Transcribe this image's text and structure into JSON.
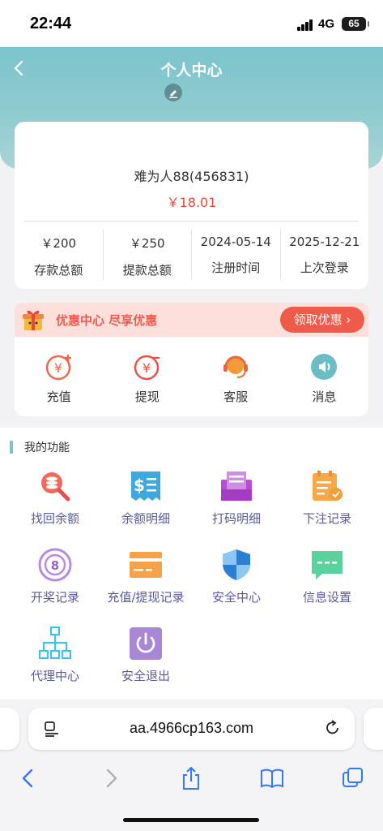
{
  "status": {
    "time": "22:44",
    "network": "4G",
    "battery": "65"
  },
  "header": {
    "title": "个人中心"
  },
  "profile": {
    "username": "难为人88(456831)",
    "balance": "￥18.01",
    "stats": [
      {
        "value": "￥200",
        "label": "存款总额"
      },
      {
        "value": "￥250",
        "label": "提款总额"
      },
      {
        "value": "2024-05-14",
        "label": "注册时间"
      },
      {
        "value": "2025-12-21",
        "label": "上次登录"
      }
    ]
  },
  "promo": {
    "text": "优惠中心 尽享优惠",
    "button": "领取优惠"
  },
  "quick_actions": [
    {
      "label": "充值",
      "icon": "deposit-icon"
    },
    {
      "label": "提现",
      "icon": "withdraw-icon"
    },
    {
      "label": "客服",
      "icon": "customer-service-icon"
    },
    {
      "label": "消息",
      "icon": "message-icon"
    }
  ],
  "functions": {
    "title": "我的功能",
    "items": [
      {
        "label": "找回余额",
        "icon": "search-coins-icon"
      },
      {
        "label": "余额明细",
        "icon": "receipt-icon"
      },
      {
        "label": "打码明细",
        "icon": "printer-icon"
      },
      {
        "label": "下注记录",
        "icon": "clipboard-check-icon"
      },
      {
        "label": "开奖记录",
        "icon": "lottery-ball-icon"
      },
      {
        "label": "充值/提现记录",
        "icon": "card-icon"
      },
      {
        "label": "安全中心",
        "icon": "shield-icon"
      },
      {
        "label": "信息设置",
        "icon": "chat-icon"
      },
      {
        "label": "代理中心",
        "icon": "org-chart-icon"
      },
      {
        "label": "安全退出",
        "icon": "power-icon"
      }
    ]
  },
  "browser": {
    "url": "aa.4966cp163.com"
  },
  "colors": {
    "header": "#7cc4cc",
    "accent_red": "#ef5b4b",
    "label_purple": "#5a5a9f"
  }
}
